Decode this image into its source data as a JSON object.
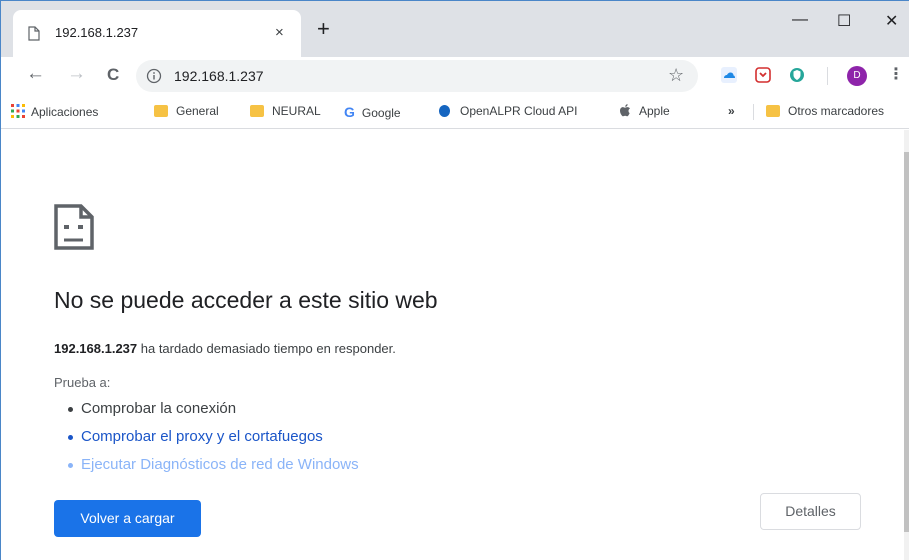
{
  "tab": {
    "title": "192.168.1.237",
    "close": "×",
    "new_tab": "+"
  },
  "window_controls": {
    "minimize": "—",
    "maximize": "☐",
    "close": "✕"
  },
  "toolbar": {
    "back": "←",
    "forward": "→",
    "reload": "C",
    "url": "192.168.1.237",
    "avatar_letter": "D"
  },
  "bookmarks": {
    "apps": "Aplicaciones",
    "items": [
      "General",
      "NEURAL",
      "Google",
      "OpenALPR Cloud API",
      "Apple"
    ],
    "overflow": "»",
    "other": "Otros marcadores"
  },
  "error": {
    "title": "No se puede acceder a este sitio web",
    "host": "192.168.1.237",
    "message": " ha tardado demasiado tiempo en responder.",
    "try_label": "Prueba a:",
    "suggestions": [
      "Comprobar la conexión",
      "Comprobar el proxy y el cortafuegos",
      "Ejecutar Diagnósticos de red de Windows"
    ],
    "reload_button": "Volver a cargar",
    "details_button": "Detalles"
  },
  "colors": {
    "accent": "#1a73e8",
    "link": "#1a55c8",
    "link_faded": "#8ab4f8",
    "titlebar": "#dee1e6"
  }
}
